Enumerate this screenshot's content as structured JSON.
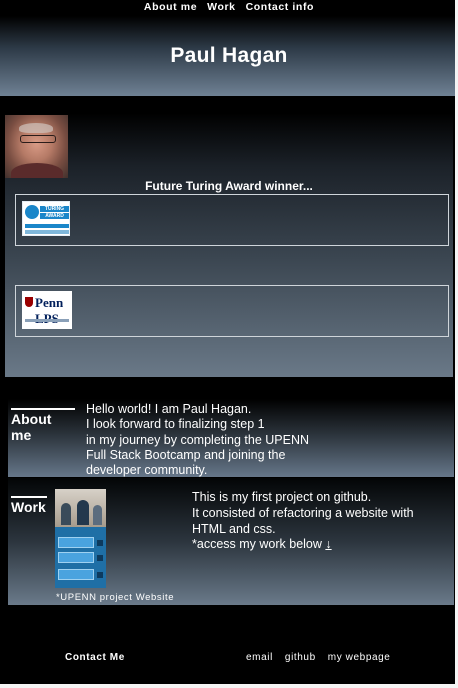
{
  "nav": {
    "items": [
      "About me",
      "Work",
      "Contact info"
    ]
  },
  "header": {
    "title": "Paul Hagan"
  },
  "hero": {
    "tagline": "Future Turing Award winner...",
    "badge1_text": {
      "top": "TURING",
      "bottom": "AWARD"
    },
    "badge2_text": "Penn LPS"
  },
  "about": {
    "title": "About me",
    "lines": [
      "Hello world! I am Paul Hagan.",
      "I look forward to finalizing step 1",
      "in my journey by completing the UPENN",
      "Full Stack Bootcamp and joining the",
      "developer community."
    ]
  },
  "work": {
    "title": "Work",
    "caption": "*UPENN project Website",
    "lines": [
      "This is my first project on github.",
      "It consisted of refactoring a website with",
      "HTML and css.",
      "*access my work below "
    ],
    "arrow": "↓"
  },
  "footer": {
    "contact": "Contact Me",
    "links": [
      "email",
      "github",
      "my webpage"
    ]
  }
}
